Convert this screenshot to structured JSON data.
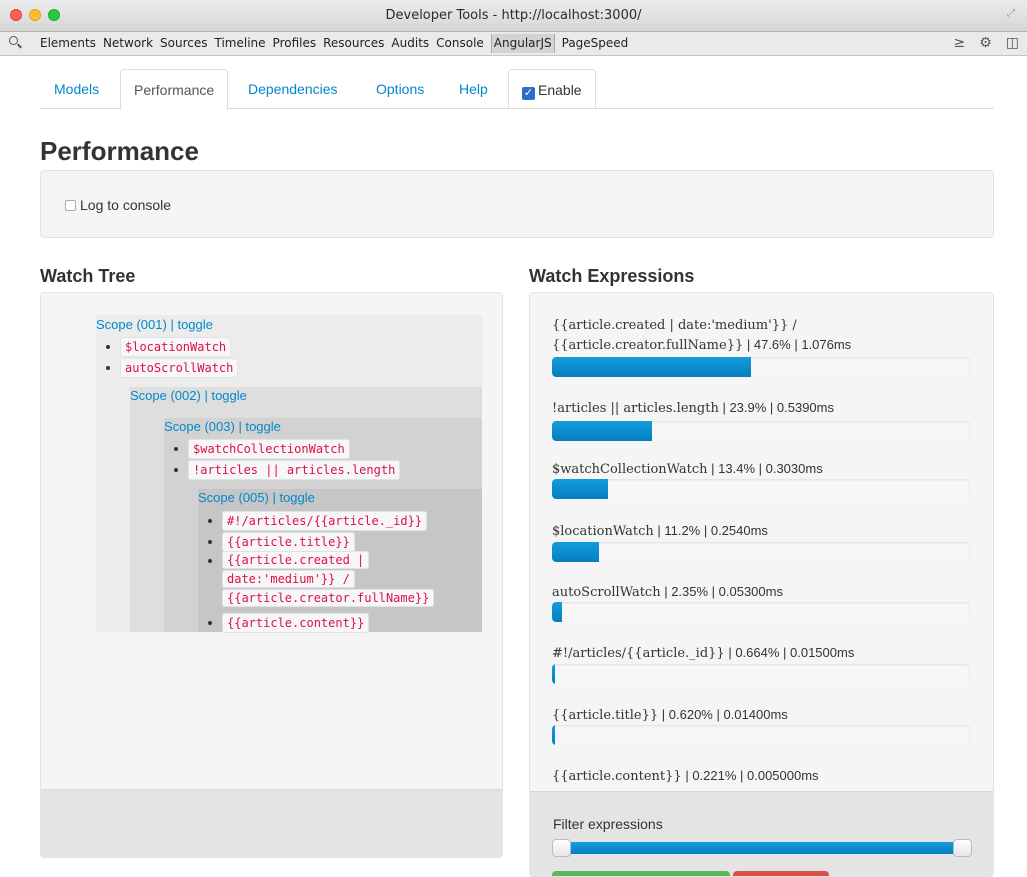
{
  "window": {
    "title": "Developer Tools - http://localhost:3000/"
  },
  "devtools": {
    "tabs": [
      "Elements",
      "Network",
      "Sources",
      "Timeline",
      "Profiles",
      "Resources",
      "Audits",
      "Console",
      "AngularJS",
      "PageSpeed"
    ],
    "active_tab": "AngularJS"
  },
  "inspector": {
    "tabs": {
      "models": "Models",
      "performance": "Performance",
      "dependencies": "Dependencies",
      "options": "Options",
      "help": "Help",
      "enable": "Enable"
    },
    "enable_checked": true,
    "title": "Performance",
    "log_to_console": "Log to console",
    "log_checked": false
  },
  "watch_tree": {
    "title": "Watch Tree",
    "toggle": "toggle",
    "scopes": [
      {
        "label": "Scope (001)",
        "items": [
          "$locationWatch",
          "autoScrollWatch"
        ]
      },
      {
        "label": "Scope (002)",
        "items": []
      },
      {
        "label": "Scope (003)",
        "items": [
          "$watchCollectionWatch",
          "!articles || articles.length"
        ]
      },
      {
        "label": "Scope (005)",
        "items": [
          "#!/articles/{{article._id}}",
          "{{article.title}}",
          "{{article.created |",
          "date:'medium'}} /",
          "{{article.creator.fullName}}",
          "{{article.content}}"
        ]
      }
    ]
  },
  "watch_expressions": {
    "title": "Watch Expressions",
    "items": [
      {
        "expr": "{{article.created | date:'medium'}} /",
        "expr2": "{{article.creator.fullName}}",
        "stats": "| 47.6% | 1.076ms",
        "percent": 47.6
      },
      {
        "expr": "!articles || articles.length",
        "stats": "| 23.9% | 0.5390ms",
        "percent": 23.9
      },
      {
        "expr": "$watchCollectionWatch",
        "stats": "| 13.4% | 0.3030ms",
        "percent": 13.4
      },
      {
        "expr": "$locationWatch",
        "stats": "| 11.2% | 0.2540ms",
        "percent": 11.2
      },
      {
        "expr": "autoScrollWatch",
        "stats": "| 2.35% | 0.05300ms",
        "percent": 2.35
      },
      {
        "expr": "#!/articles/{{article._id}}",
        "stats": "| 0.664% | 0.01500ms",
        "percent": 0.664
      },
      {
        "expr": "{{article.title}}",
        "stats": "| 0.620% | 0.01400ms",
        "percent": 0.62
      },
      {
        "expr": "{{article.content}}",
        "stats": "| 0.221% | 0.005000ms",
        "percent": 0.221
      }
    ],
    "filter_label": "Filter expressions",
    "filter_range": [
      0,
      100
    ]
  },
  "colors": {
    "link": "#0088cc",
    "code": "#dd1144",
    "bar": "#0480be",
    "success": "#5bb75b",
    "danger": "#da4f49"
  }
}
